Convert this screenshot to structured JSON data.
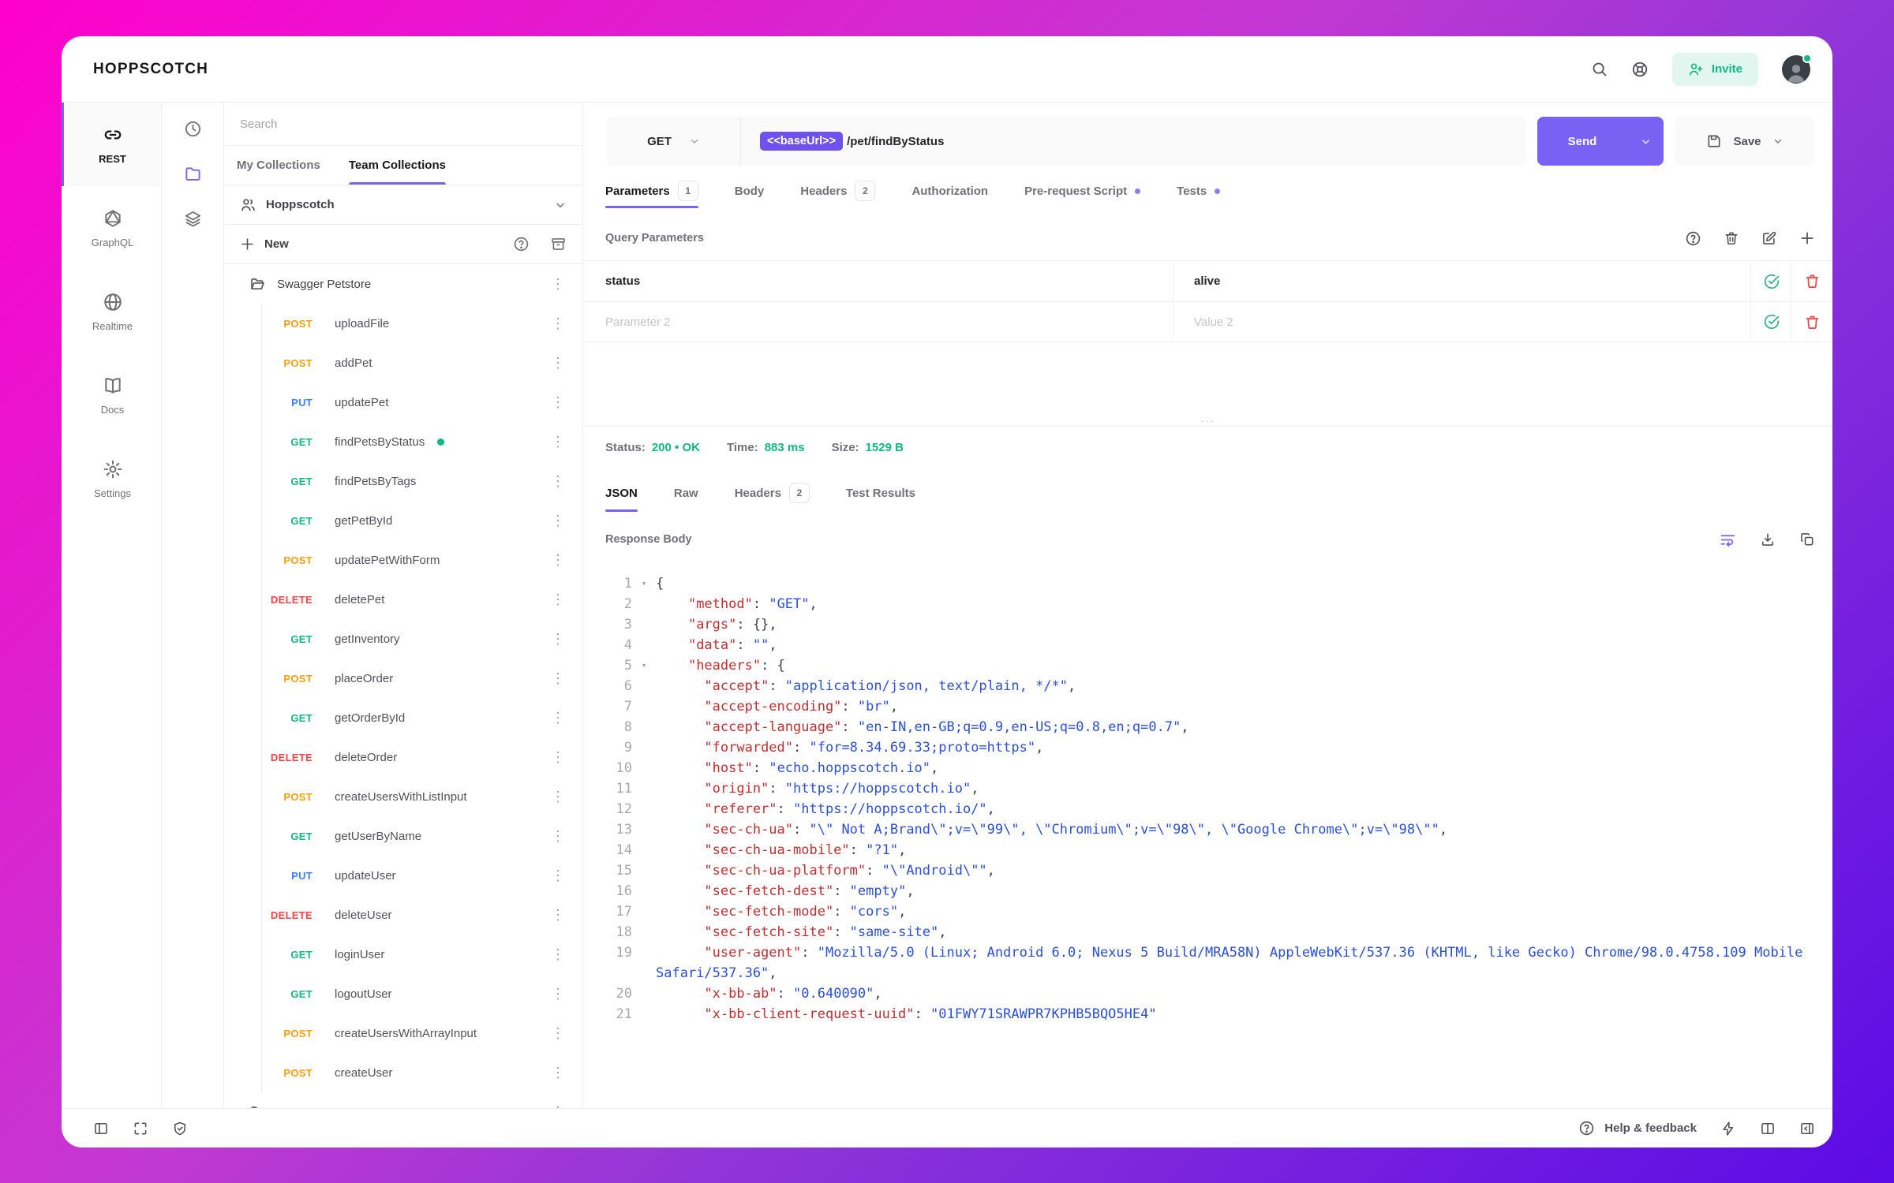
{
  "colors": {
    "accent": "#7961f4",
    "env_pill": "#6f52ee",
    "green": "#10b981",
    "get": "#10b981",
    "post": "#f59e0b",
    "put": "#3b82f6",
    "delete": "#ef4444",
    "json_key": "#c22f2f",
    "json_string": "#2b50d8"
  },
  "topbar": {
    "logo": "HOPPSCOTCH",
    "invite_label": "Invite"
  },
  "nav": {
    "items": [
      {
        "label": "REST",
        "active": true
      },
      {
        "label": "GraphQL",
        "active": false
      },
      {
        "label": "Realtime",
        "active": false
      },
      {
        "label": "Docs",
        "active": false
      },
      {
        "label": "Settings",
        "active": false
      }
    ]
  },
  "collections": {
    "search_placeholder": "Search",
    "tabs": [
      {
        "label": "My Collections",
        "active": false
      },
      {
        "label": "Team Collections",
        "active": true
      }
    ],
    "team_name": "Hoppscotch",
    "new_label": "New",
    "folder_name": "Swagger Petstore",
    "requests": [
      {
        "method": "POST",
        "name": "uploadFile"
      },
      {
        "method": "POST",
        "name": "addPet"
      },
      {
        "method": "PUT",
        "name": "updatePet"
      },
      {
        "method": "GET",
        "name": "findPetsByStatus",
        "active": true
      },
      {
        "method": "GET",
        "name": "findPetsByTags"
      },
      {
        "method": "GET",
        "name": "getPetById"
      },
      {
        "method": "POST",
        "name": "updatePetWithForm"
      },
      {
        "method": "DELETE",
        "name": "deletePet"
      },
      {
        "method": "GET",
        "name": "getInventory"
      },
      {
        "method": "POST",
        "name": "placeOrder"
      },
      {
        "method": "GET",
        "name": "getOrderById"
      },
      {
        "method": "DELETE",
        "name": "deleteOrder"
      },
      {
        "method": "POST",
        "name": "createUsersWithListInput"
      },
      {
        "method": "GET",
        "name": "getUserByName"
      },
      {
        "method": "PUT",
        "name": "updateUser"
      },
      {
        "method": "DELETE",
        "name": "deleteUser"
      },
      {
        "method": "GET",
        "name": "loginUser"
      },
      {
        "method": "GET",
        "name": "logoutUser"
      },
      {
        "method": "POST",
        "name": "createUsersWithArrayInput"
      },
      {
        "method": "POST",
        "name": "createUser"
      }
    ]
  },
  "request": {
    "method": "GET",
    "url_variable": "<<baseUrl>>",
    "url_path": "/pet/findByStatus",
    "send_label": "Send",
    "save_label": "Save",
    "tabs": [
      {
        "label": "Parameters",
        "badge": "1",
        "active": true
      },
      {
        "label": "Body"
      },
      {
        "label": "Headers",
        "badge": "2"
      },
      {
        "label": "Authorization"
      },
      {
        "label": "Pre-request Script",
        "dot": true
      },
      {
        "label": "Tests",
        "dot": true
      }
    ],
    "section_title": "Query Parameters",
    "params": [
      {
        "key": "status",
        "value": "alive",
        "placeholder": false
      },
      {
        "key": "Parameter 2",
        "value": "Value 2",
        "placeholder": true
      }
    ]
  },
  "response": {
    "status_label": "Status:",
    "status_value": "200 • OK",
    "time_label": "Time:",
    "time_value": "883 ms",
    "size_label": "Size:",
    "size_value": "1529 B",
    "tabs": [
      {
        "label": "JSON",
        "active": true
      },
      {
        "label": "Raw"
      },
      {
        "label": "Headers",
        "badge": "2"
      },
      {
        "label": "Test Results"
      }
    ],
    "body_label": "Response Body",
    "code": [
      {
        "n": "1",
        "fold": true,
        "parts": [
          [
            "p",
            "{"
          ]
        ]
      },
      {
        "n": "2",
        "parts": [
          [
            "p",
            "    "
          ],
          [
            "k",
            "\"method\""
          ],
          [
            "p",
            ": "
          ],
          [
            "s",
            "\"GET\""
          ],
          [
            "p",
            ","
          ]
        ]
      },
      {
        "n": "3",
        "parts": [
          [
            "p",
            "    "
          ],
          [
            "k",
            "\"args\""
          ],
          [
            "p",
            ": {},"
          ]
        ]
      },
      {
        "n": "4",
        "parts": [
          [
            "p",
            "    "
          ],
          [
            "k",
            "\"data\""
          ],
          [
            "p",
            ": "
          ],
          [
            "s",
            "\"\""
          ],
          [
            "p",
            ","
          ]
        ]
      },
      {
        "n": "5",
        "fold": true,
        "parts": [
          [
            "p",
            "    "
          ],
          [
            "k",
            "\"headers\""
          ],
          [
            "p",
            ": {"
          ]
        ]
      },
      {
        "n": "6",
        "parts": [
          [
            "p",
            "      "
          ],
          [
            "k",
            "\"accept\""
          ],
          [
            "p",
            ": "
          ],
          [
            "s",
            "\"application/json, text/plain, */*\""
          ],
          [
            "p",
            ","
          ]
        ]
      },
      {
        "n": "7",
        "parts": [
          [
            "p",
            "      "
          ],
          [
            "k",
            "\"accept-encoding\""
          ],
          [
            "p",
            ": "
          ],
          [
            "s",
            "\"br\""
          ],
          [
            "p",
            ","
          ]
        ]
      },
      {
        "n": "8",
        "parts": [
          [
            "p",
            "      "
          ],
          [
            "k",
            "\"accept-language\""
          ],
          [
            "p",
            ": "
          ],
          [
            "s",
            "\"en-IN,en-GB;q=0.9,en-US;q=0.8,en;q=0.7\""
          ],
          [
            "p",
            ","
          ]
        ]
      },
      {
        "n": "9",
        "parts": [
          [
            "p",
            "      "
          ],
          [
            "k",
            "\"forwarded\""
          ],
          [
            "p",
            ": "
          ],
          [
            "s",
            "\"for=8.34.69.33;proto=https\""
          ],
          [
            "p",
            ","
          ]
        ]
      },
      {
        "n": "10",
        "parts": [
          [
            "p",
            "      "
          ],
          [
            "k",
            "\"host\""
          ],
          [
            "p",
            ": "
          ],
          [
            "s",
            "\"echo.hoppscotch.io\""
          ],
          [
            "p",
            ","
          ]
        ]
      },
      {
        "n": "11",
        "parts": [
          [
            "p",
            "      "
          ],
          [
            "k",
            "\"origin\""
          ],
          [
            "p",
            ": "
          ],
          [
            "s",
            "\"https://hoppscotch.io\""
          ],
          [
            "p",
            ","
          ]
        ]
      },
      {
        "n": "12",
        "parts": [
          [
            "p",
            "      "
          ],
          [
            "k",
            "\"referer\""
          ],
          [
            "p",
            ": "
          ],
          [
            "s",
            "\"https://hoppscotch.io/\""
          ],
          [
            "p",
            ","
          ]
        ]
      },
      {
        "n": "13",
        "parts": [
          [
            "p",
            "      "
          ],
          [
            "k",
            "\"sec-ch-ua\""
          ],
          [
            "p",
            ": "
          ],
          [
            "s",
            "\"\\\" Not A;Brand\\\";v=\\\"99\\\", \\\"Chromium\\\";v=\\\"98\\\", \\\"Google Chrome\\\";v=\\\"98\\\"\""
          ],
          [
            "p",
            ","
          ]
        ]
      },
      {
        "n": "14",
        "parts": [
          [
            "p",
            "      "
          ],
          [
            "k",
            "\"sec-ch-ua-mobile\""
          ],
          [
            "p",
            ": "
          ],
          [
            "s",
            "\"?1\""
          ],
          [
            "p",
            ","
          ]
        ]
      },
      {
        "n": "15",
        "parts": [
          [
            "p",
            "      "
          ],
          [
            "k",
            "\"sec-ch-ua-platform\""
          ],
          [
            "p",
            ": "
          ],
          [
            "s",
            "\"\\\"Android\\\"\""
          ],
          [
            "p",
            ","
          ]
        ]
      },
      {
        "n": "16",
        "parts": [
          [
            "p",
            "      "
          ],
          [
            "k",
            "\"sec-fetch-dest\""
          ],
          [
            "p",
            ": "
          ],
          [
            "s",
            "\"empty\""
          ],
          [
            "p",
            ","
          ]
        ]
      },
      {
        "n": "17",
        "parts": [
          [
            "p",
            "      "
          ],
          [
            "k",
            "\"sec-fetch-mode\""
          ],
          [
            "p",
            ": "
          ],
          [
            "s",
            "\"cors\""
          ],
          [
            "p",
            ","
          ]
        ]
      },
      {
        "n": "18",
        "parts": [
          [
            "p",
            "      "
          ],
          [
            "k",
            "\"sec-fetch-site\""
          ],
          [
            "p",
            ": "
          ],
          [
            "s",
            "\"same-site\""
          ],
          [
            "p",
            ","
          ]
        ]
      },
      {
        "n": "19",
        "parts": [
          [
            "p",
            "      "
          ],
          [
            "k",
            "\"user-agent\""
          ],
          [
            "p",
            ": "
          ],
          [
            "s",
            "\"Mozilla/5.0 (Linux; Android 6.0; Nexus 5 Build/MRA58N) AppleWebKit/537.36 (KHTML, like Gecko) Chrome/98.0.4758.109 Mobile Safari/537.36\""
          ],
          [
            "p",
            ","
          ]
        ]
      },
      {
        "n": "20",
        "parts": [
          [
            "p",
            "      "
          ],
          [
            "k",
            "\"x-bb-ab\""
          ],
          [
            "p",
            ": "
          ],
          [
            "s",
            "\"0.640090\""
          ],
          [
            "p",
            ","
          ]
        ]
      },
      {
        "n": "21",
        "parts": [
          [
            "p",
            "      "
          ],
          [
            "k",
            "\"x-bb-client-request-uuid\""
          ],
          [
            "p",
            ": "
          ],
          [
            "s",
            "\"01FWY71SRAWPR7KPHB5BQO5HE4\""
          ]
        ]
      }
    ]
  },
  "footer": {
    "help_label": "Help & feedback"
  }
}
